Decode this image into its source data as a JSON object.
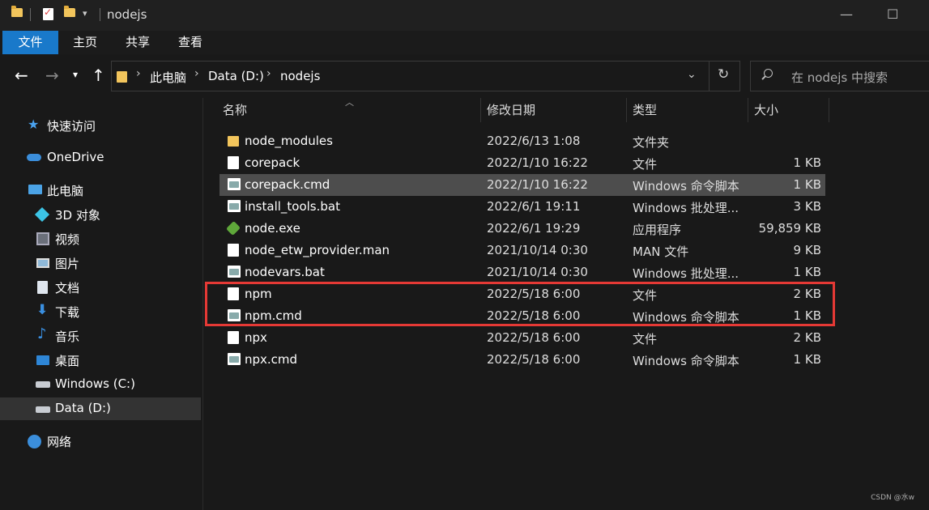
{
  "window": {
    "title": "nodejs",
    "minimize_glyph": "—",
    "maximize_glyph": "☐"
  },
  "ribbon": {
    "tabs": [
      {
        "label": "文件",
        "active": true
      },
      {
        "label": "主页",
        "active": false
      },
      {
        "label": "共享",
        "active": false
      },
      {
        "label": "查看",
        "active": false
      }
    ]
  },
  "address": {
    "crumbs": [
      "此电脑",
      "Data (D:)",
      "nodejs"
    ],
    "search_placeholder": "在 nodejs 中搜索"
  },
  "sidebar": {
    "items": [
      {
        "label": "快速访问",
        "icon": "star-icon"
      },
      {
        "label": "OneDrive",
        "icon": "cloud-icon"
      },
      {
        "label": "此电脑",
        "icon": "computer-icon"
      },
      {
        "label": "3D 对象",
        "icon": "cube-icon"
      },
      {
        "label": "视频",
        "icon": "video-icon"
      },
      {
        "label": "图片",
        "icon": "picture-icon"
      },
      {
        "label": "文档",
        "icon": "document-icon"
      },
      {
        "label": "下载",
        "icon": "download-icon"
      },
      {
        "label": "音乐",
        "icon": "music-icon"
      },
      {
        "label": "桌面",
        "icon": "desktop-icon"
      },
      {
        "label": "Windows (C:)",
        "icon": "drive-c-icon"
      },
      {
        "label": "Data (D:)",
        "icon": "drive-d-icon",
        "selected": true
      },
      {
        "label": "网络",
        "icon": "network-icon"
      }
    ]
  },
  "columns": {
    "name": "名称",
    "date": "修改日期",
    "type": "类型",
    "size": "大小"
  },
  "files": [
    {
      "name": "node_modules",
      "date": "2022/6/13 1:08",
      "type": "文件夹",
      "size": "",
      "icon": "folder-icon"
    },
    {
      "name": "corepack",
      "date": "2022/1/10 16:22",
      "type": "文件",
      "size": "1 KB",
      "icon": "file-icon"
    },
    {
      "name": "corepack.cmd",
      "date": "2022/1/10 16:22",
      "type": "Windows 命令脚本",
      "size": "1 KB",
      "icon": "cmd-icon",
      "hover": true
    },
    {
      "name": "install_tools.bat",
      "date": "2022/6/1 19:11",
      "type": "Windows 批处理...",
      "size": "3 KB",
      "icon": "bat-icon"
    },
    {
      "name": "node.exe",
      "date": "2022/6/1 19:29",
      "type": "应用程序",
      "size": "59,859 KB",
      "icon": "node-exe-icon"
    },
    {
      "name": "node_etw_provider.man",
      "date": "2021/10/14 0:30",
      "type": "MAN 文件",
      "size": "9 KB",
      "icon": "file-icon"
    },
    {
      "name": "nodevars.bat",
      "date": "2021/10/14 0:30",
      "type": "Windows 批处理...",
      "size": "1 KB",
      "icon": "bat-icon"
    },
    {
      "name": "npm",
      "date": "2022/5/18 6:00",
      "type": "文件",
      "size": "2 KB",
      "icon": "file-icon"
    },
    {
      "name": "npm.cmd",
      "date": "2022/5/18 6:00",
      "type": "Windows 命令脚本",
      "size": "1 KB",
      "icon": "cmd-icon"
    },
    {
      "name": "npx",
      "date": "2022/5/18 6:00",
      "type": "文件",
      "size": "2 KB",
      "icon": "file-icon"
    },
    {
      "name": "npx.cmd",
      "date": "2022/5/18 6:00",
      "type": "Windows 命令脚本",
      "size": "1 KB",
      "icon": "cmd-icon"
    }
  ],
  "annotation": {
    "highlight_color": "#e53935"
  },
  "watermark": "CSDN @水w",
  "colors": {
    "accent": "#1979ca",
    "background": "#191919",
    "hover_row": "#4d4d4d"
  }
}
